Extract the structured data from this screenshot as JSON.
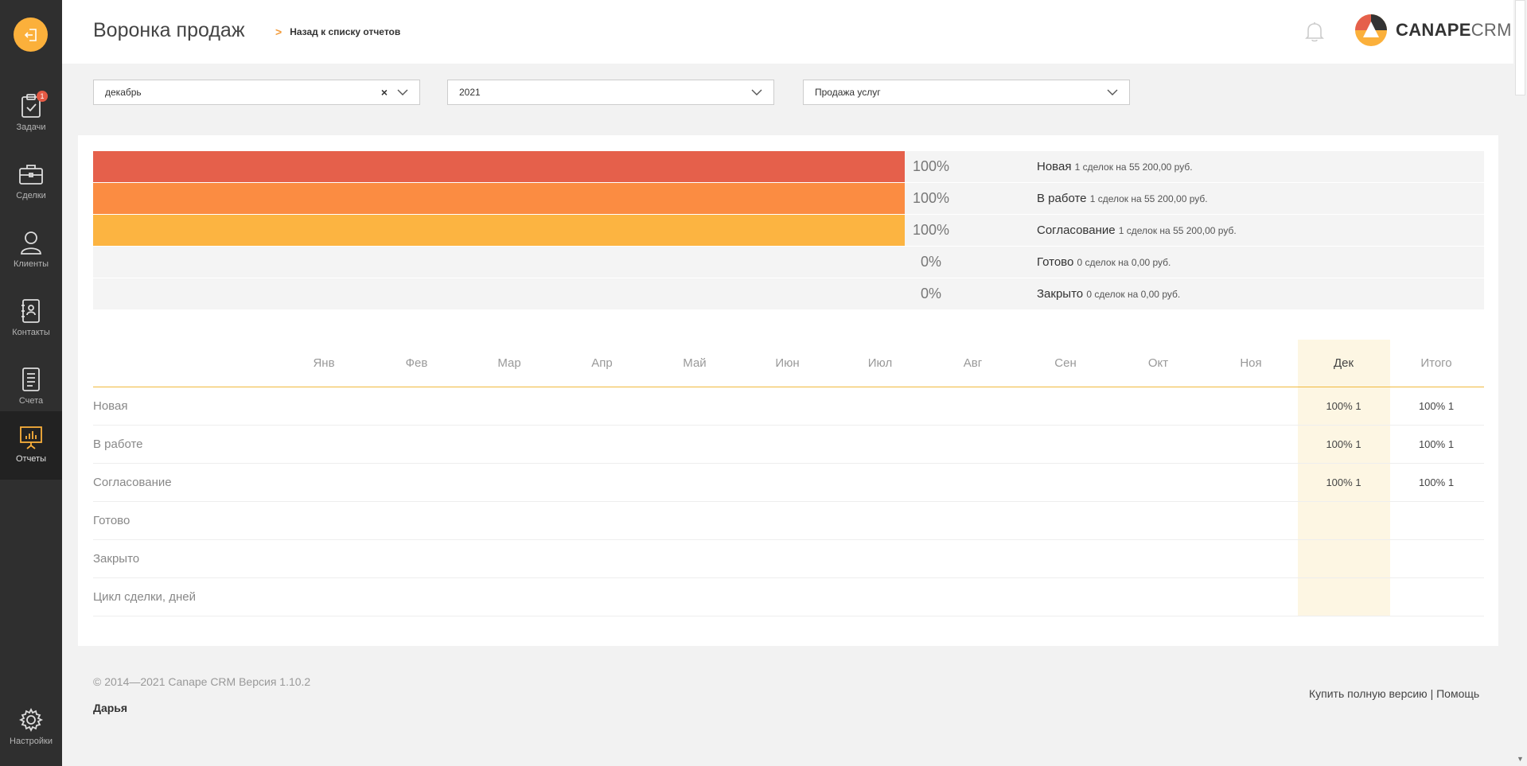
{
  "sidebar": {
    "exit_icon": "exit-icon",
    "items": [
      {
        "label": "Задачи",
        "icon": "clipboard-check-icon",
        "badge": "1"
      },
      {
        "label": "Сделки",
        "icon": "briefcase-icon"
      },
      {
        "label": "Клиенты",
        "icon": "user-icon"
      },
      {
        "label": "Контакты",
        "icon": "address-book-icon"
      },
      {
        "label": "Счета",
        "icon": "document-icon"
      },
      {
        "label": "Отчеты",
        "icon": "presentation-chart-icon",
        "active": true
      },
      {
        "label": "Настройки",
        "icon": "gear-icon"
      }
    ]
  },
  "header": {
    "title": "Воронка продаж",
    "back_link": "Назад к списку отчетов",
    "logo_bold": "CANAPE",
    "logo_light": "CRM"
  },
  "filters": {
    "month": "декабрь",
    "year": "2021",
    "funnel": "Продажа услуг"
  },
  "colors": {
    "accent": "#fbb03b",
    "stage_new": "#e5604b",
    "stage_work": "#fb8c42",
    "stage_approval": "#fcb441",
    "highlight_col": "#fdf6e3"
  },
  "funnel": [
    {
      "name": "Новая",
      "percent": "100%",
      "detail": "1 сделок на 55 200,00 руб.",
      "fill": 1.0,
      "color": "#e5604b"
    },
    {
      "name": "В работе",
      "percent": "100%",
      "detail": "1 сделок на 55 200,00 руб.",
      "fill": 1.0,
      "color": "#fb8c42"
    },
    {
      "name": "Согласование",
      "percent": "100%",
      "detail": "1 сделок на 55 200,00 руб.",
      "fill": 1.0,
      "color": "#fcb441"
    },
    {
      "name": "Готово",
      "percent": "0%",
      "detail": "0 сделок на 0,00 руб.",
      "fill": 0.0,
      "color": "#fcb441"
    },
    {
      "name": "Закрыто",
      "percent": "0%",
      "detail": "0 сделок на 0,00 руб.",
      "fill": 0.0,
      "color": "#fcb441"
    }
  ],
  "table": {
    "months": [
      "Янв",
      "Фев",
      "Мар",
      "Апр",
      "Май",
      "Июн",
      "Июл",
      "Авг",
      "Сен",
      "Окт",
      "Ноя",
      "Дек",
      "Итого"
    ],
    "rows": [
      {
        "name": "Новая",
        "dec": "100% 1",
        "total": "100% 1"
      },
      {
        "name": "В работе",
        "dec": "100% 1",
        "total": "100% 1"
      },
      {
        "name": "Согласование",
        "dec": "100% 1",
        "total": "100% 1"
      },
      {
        "name": "Готово",
        "dec": "",
        "total": ""
      },
      {
        "name": "Закрыто",
        "dec": "",
        "total": ""
      },
      {
        "name": "Цикл сделки, дней",
        "dec": "",
        "total": ""
      }
    ]
  },
  "footer": {
    "copyright": "© 2014—2021 Canape CRM Версия 1.10.2",
    "user": "Дарья",
    "buy_link": "Купить полную версию",
    "separator": "|",
    "help_link": "Помощь"
  }
}
